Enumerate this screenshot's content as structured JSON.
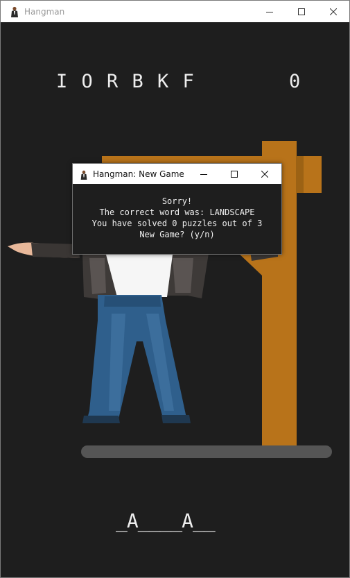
{
  "window": {
    "title": "Hangman",
    "icon": "person-icon",
    "controls": [
      "minimize",
      "maximize",
      "close"
    ]
  },
  "game": {
    "guessed_letters": "I O R B K F",
    "wrong_count": "0",
    "word_display": "_A____A__"
  },
  "dialog": {
    "title": "Hangman: New Game",
    "lines": [
      "Sorry!",
      "The correct word was: LANDSCAPE",
      "You have solved 0 puzzles out of 3",
      "New Game? (y/n)"
    ]
  },
  "colors": {
    "background": "#1e1e1e",
    "gallows": "#b8731a",
    "gallows_dark": "#9c6214",
    "platform": "#555555",
    "text": "#eeeeee"
  }
}
